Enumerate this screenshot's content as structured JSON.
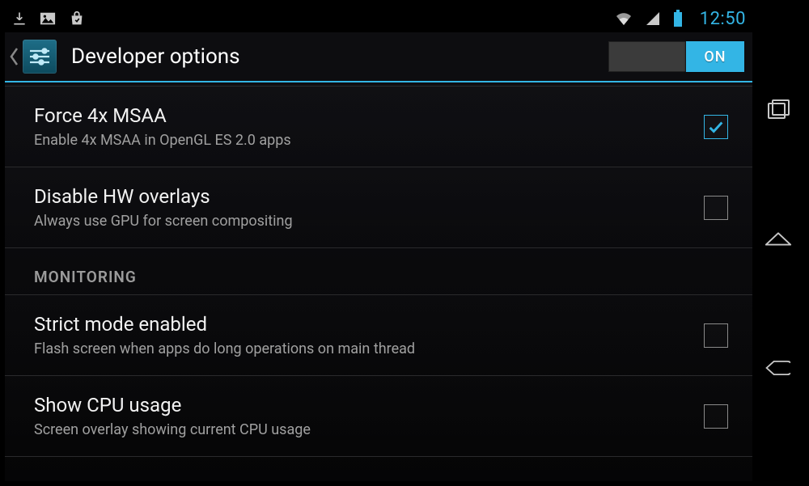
{
  "status": {
    "clock": "12:50"
  },
  "actionbar": {
    "title": "Developer options",
    "switch_on_label": "ON"
  },
  "sections": {
    "monitoring_header": "MONITORING"
  },
  "items": {
    "force_msaa": {
      "title": "Force 4x MSAA",
      "sub": "Enable 4x MSAA in OpenGL ES 2.0 apps",
      "checked": true
    },
    "disable_hw_overlays": {
      "title": "Disable HW overlays",
      "sub": "Always use GPU for screen compositing",
      "checked": false
    },
    "strict_mode": {
      "title": "Strict mode enabled",
      "sub": "Flash screen when apps do long operations on main thread",
      "checked": false
    },
    "show_cpu": {
      "title": "Show CPU usage",
      "sub": "Screen overlay showing current CPU usage",
      "checked": false
    }
  }
}
